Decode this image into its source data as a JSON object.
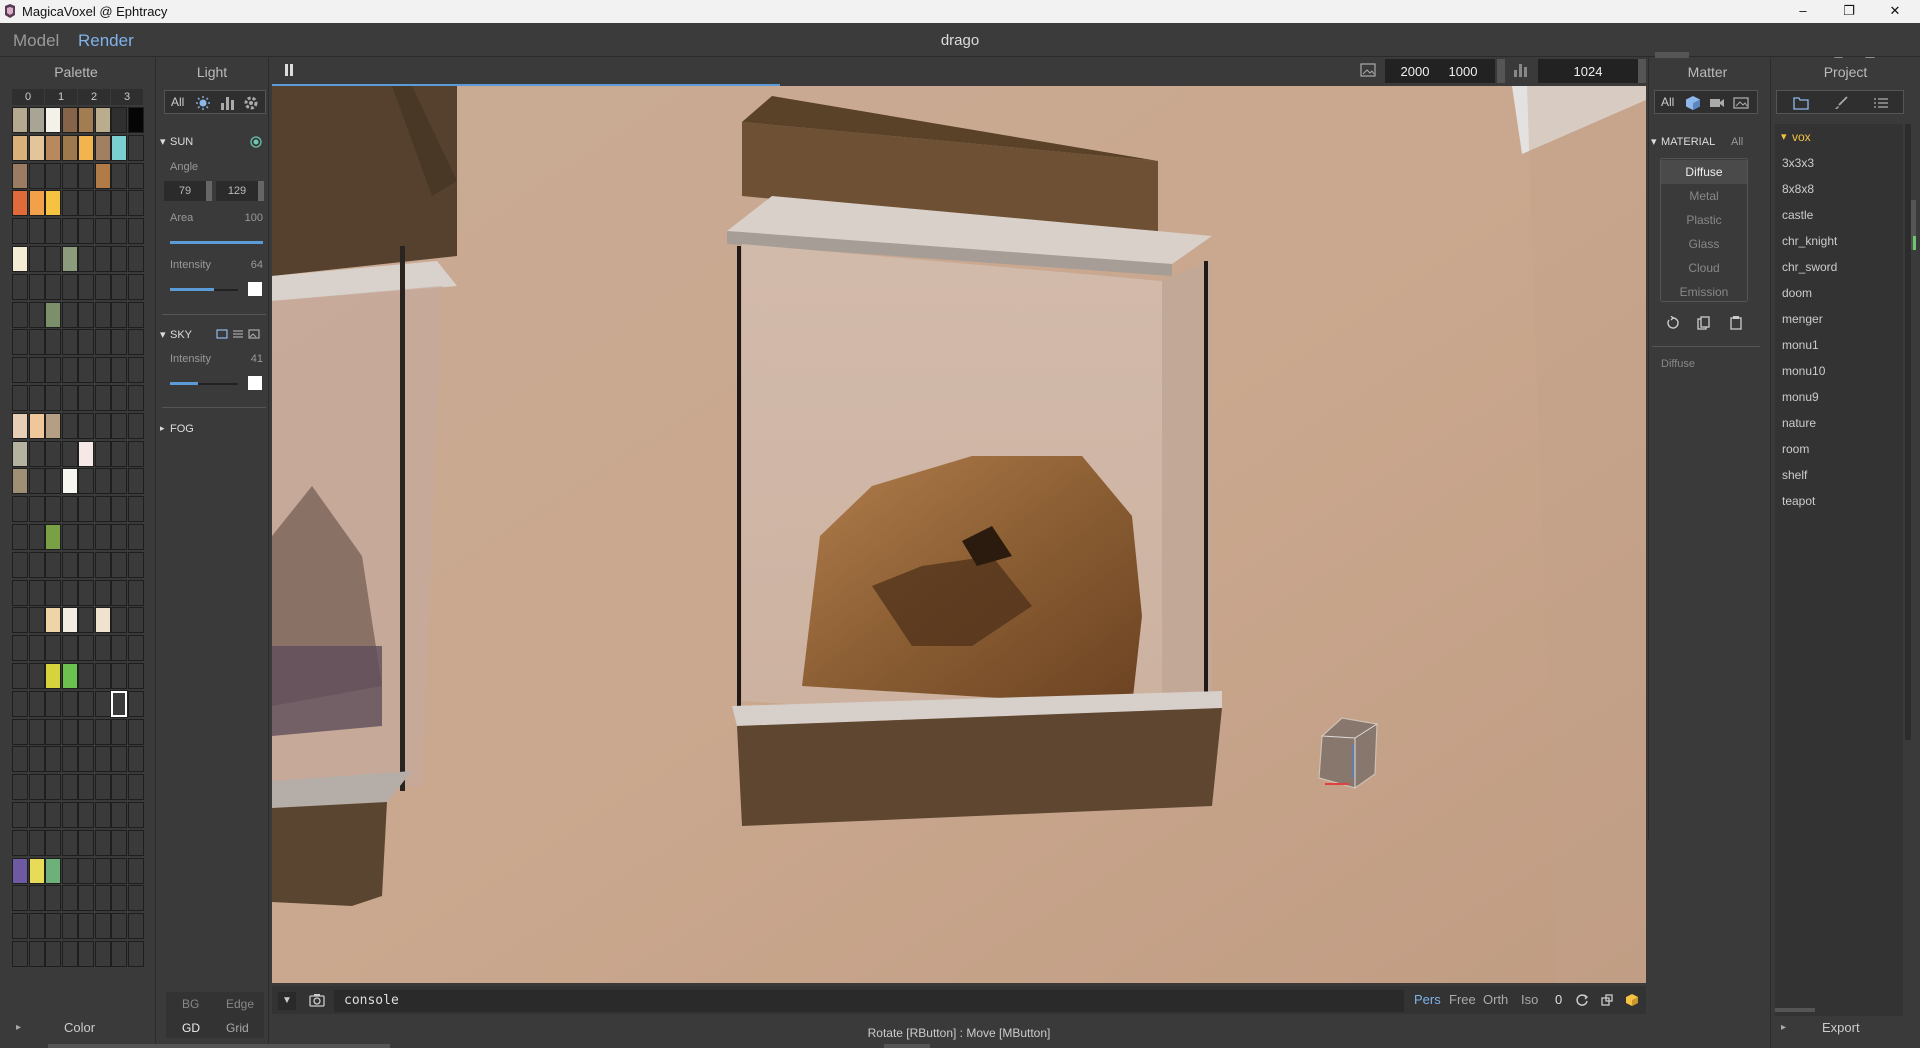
{
  "window": {
    "title": "MagicaVoxel @ Ephtracy",
    "minimize": "–",
    "restore": "❐",
    "close": "✕"
  },
  "topbar": {
    "mode_model": "Model",
    "mode_render": "Render",
    "document_title": "drago"
  },
  "colors": {
    "accent_blue": "#5b9bd8",
    "active_orange": "#f5c242",
    "save_red": "#e05050"
  },
  "palette": {
    "title": "Palette",
    "columns": [
      "0",
      "1",
      "2",
      "3"
    ],
    "footer_label": "Color",
    "footer_arrow": "▸"
  },
  "light": {
    "title": "Light",
    "tab_all": "All",
    "sun": {
      "header": "SUN",
      "angle_label": "Angle",
      "angle_1": "79",
      "angle_2": "129",
      "area_label": "Area",
      "area_value": "100",
      "intensity_label": "Intensity",
      "intensity_value": "64",
      "intensity_level": 0.64
    },
    "sky": {
      "header": "SKY",
      "intensity_label": "Intensity",
      "intensity_value": "41",
      "intensity_level": 0.41
    },
    "fog": {
      "header": "FOG"
    },
    "bottom": {
      "bg": "BG",
      "edge": "Edge",
      "gd": "GD",
      "grid": "Grid"
    }
  },
  "render_toolbar": {
    "width": "2000",
    "height": "1000",
    "samples": "1024",
    "progress": 0.37
  },
  "matter": {
    "title": "Matter",
    "tab_all": "All",
    "material_header": "MATERIAL",
    "material_all": "All",
    "materials": [
      "Diffuse",
      "Metal",
      "Plastic",
      "Glass",
      "Cloud",
      "Emission"
    ],
    "selected": "Diffuse",
    "current_label": "Diffuse"
  },
  "project": {
    "title": "Project",
    "folder": "vox",
    "files": [
      "3x3x3",
      "8x8x8",
      "castle",
      "chr_knight",
      "chr_sword",
      "doom",
      "menger",
      "monu1",
      "monu10",
      "monu9",
      "nature",
      "room",
      "shelf",
      "teapot"
    ],
    "export_label": "Export"
  },
  "console": {
    "text": "console"
  },
  "view_options": {
    "pers": "Pers",
    "free": "Free",
    "orth": "Orth",
    "iso": "Iso",
    "zero": "0"
  },
  "status": {
    "hint": "Rotate [RButton] : Move [MButton]"
  }
}
